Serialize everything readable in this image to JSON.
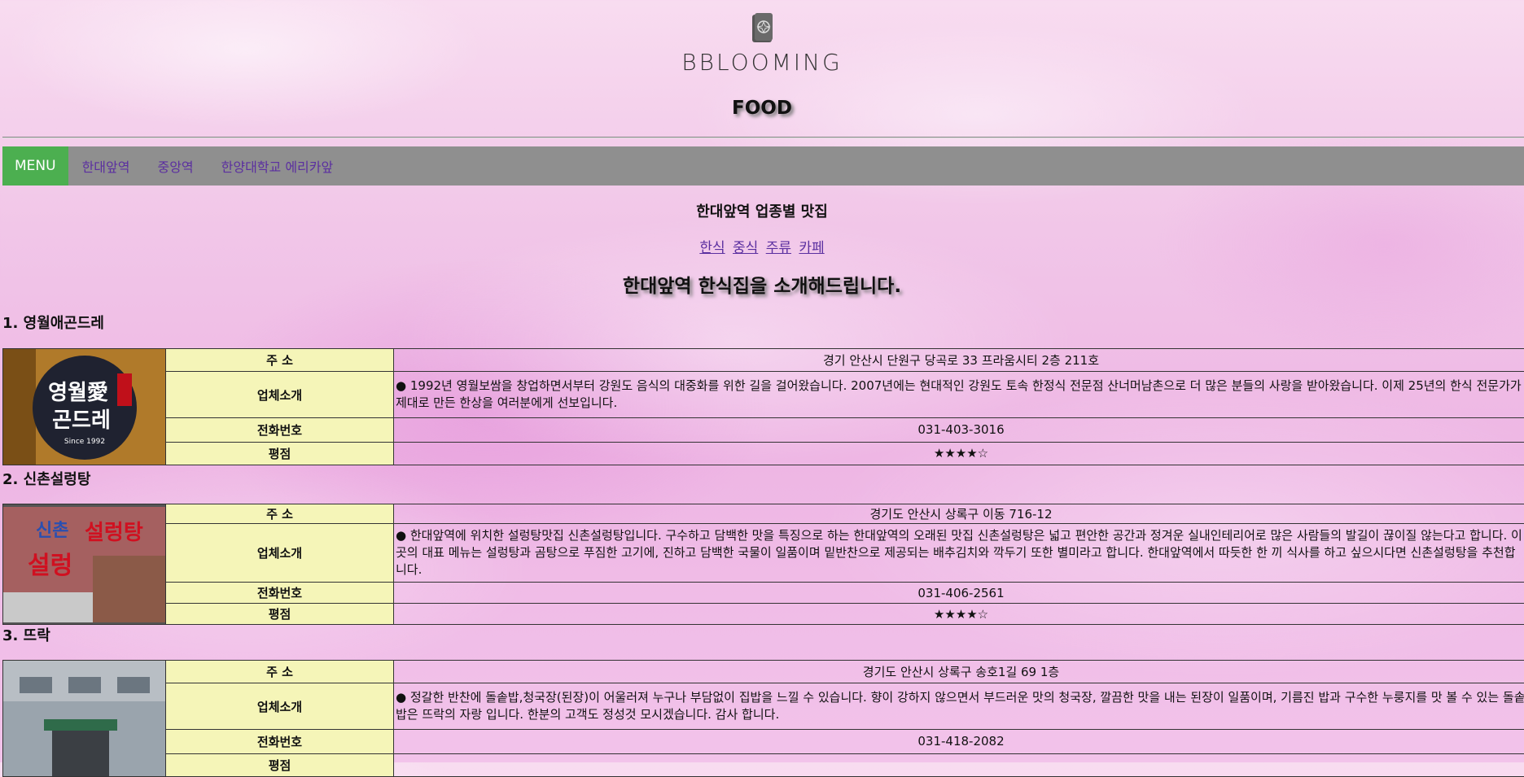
{
  "header": {
    "logo_text": "BBLOOMING",
    "page_title": "FOOD"
  },
  "nav": {
    "menu_label": "MENU",
    "items": [
      "한대앞역",
      "중앙역",
      "한양대학교 에리카앞"
    ]
  },
  "section": {
    "subtitle": "한대앞역 업종별 맛집",
    "categories": [
      "한식",
      "중식",
      "주류",
      "카페"
    ],
    "intro": "한대앞역 한식집을 소개해드립니다."
  },
  "labels": {
    "address": "주 소",
    "intro": "업체소개",
    "phone": "전화번호",
    "rating": "평점"
  },
  "restaurants": [
    {
      "title": "1. 영월애곤드레",
      "address": "경기 안산시 단원구 당곡로 33 프라움시티 2층 211호",
      "intro": "● 1992년 영월보쌈을 창업하면서부터 강원도 음식의 대중화를 위한 길을 걸어왔습니다. 2007년에는 현대적인 강원도 토속 한정식 전문점 산너머남촌으로 더 많은 분들의 사랑을 받아왔습니다. 이제 25년의 한식 전문가가 제대로 만든 한상을 여러분에게 선보입니다.",
      "phone": "031-403-3016",
      "rating": "★★★★☆",
      "image_text": "영월愛 곤드레"
    },
    {
      "title": "2. 신촌설렁탕",
      "address": "경기도 안산시 상록구 이동 716-12",
      "intro": "● 한대앞역에 위치한 설렁탕맛집 신촌설렁탕입니다. 구수하고 담백한 맛을 특징으로 하는 한대앞역의 오래된 맛집 신촌설렁탕은 넓고 편안한 공간과 정겨운 실내인테리어로 많은 사람들의 발길이 끊이질 않는다고 합니다. 이 곳의 대표 메뉴는 설렁탕과 곰탕으로 푸짐한 고기에, 진하고 담백한 국물이 일품이며 밑반찬으로 제공되는 배추김치와 깍두기 또한 별미라고 합니다. 한대앞역에서 따듯한 한 끼 식사를 하고 싶으시다면 신촌설렁탕을 추천합니다.",
      "phone": "031-406-2561",
      "rating": "★★★★☆",
      "image_text": "신촌 설렁탕"
    },
    {
      "title": "3. 뜨락",
      "address": "경기도 안산시 상록구 송호1길 69 1층",
      "intro": "● 정갈한 반찬에 돌솥밥,청국장(된장)이 어울러져 누구나 부담없이 집밥을 느낄 수 있습니다. 향이 강하지 않으면서 부드러운 맛의 청국장, 깔끔한 맛을 내는 된장이 일품이며, 기름진 밥과 구수한 누룽지를 맛 볼 수 있는 돌솥밥은 뜨락의 자랑 입니다. 한분의 고객도 정성것 모시겠습니다. 감사 합니다.",
      "phone": "031-418-2082",
      "rating": "",
      "image_text": ""
    }
  ],
  "colors": {
    "menu_bg": "#4caf50",
    "nav_bg": "#8f8f8f",
    "label_bg": "#f5f5b8",
    "link": "#5b2fa0"
  }
}
